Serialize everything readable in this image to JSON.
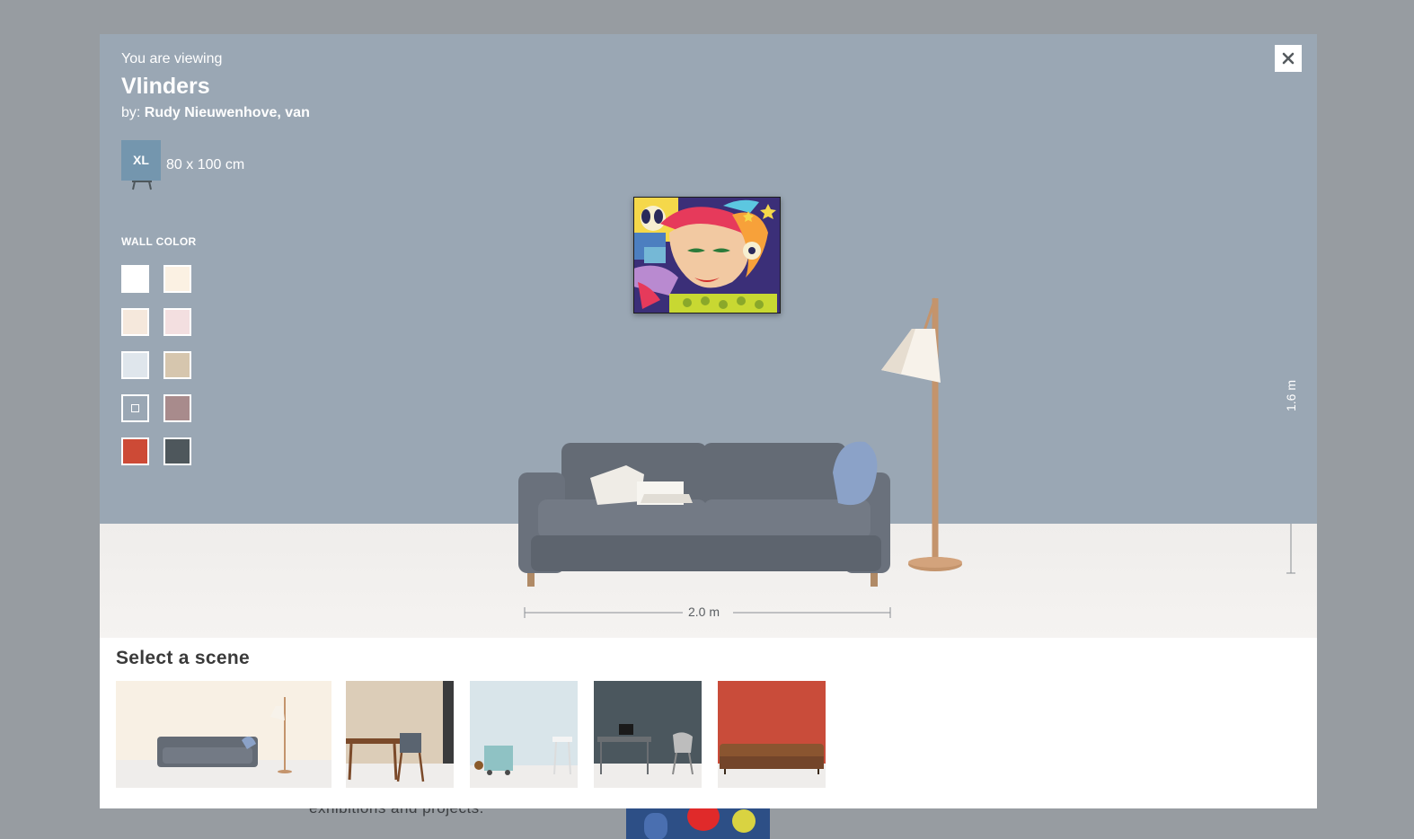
{
  "background": {
    "text": "exhibitions and projects."
  },
  "header": {
    "viewing_label": "You are viewing",
    "artwork_title": "Vlinders",
    "by_prefix": "by:",
    "artist_name": "Rudy Nieuwenhove, van"
  },
  "size": {
    "badge": "XL",
    "dimensions": "80 x 100 cm"
  },
  "wall_color": {
    "label": "WALL COLOR",
    "swatches": [
      "#ffffff",
      "#fbf1e3",
      "#f5e8dc",
      "#f3dfe0",
      "#dfe6ec",
      "#d6c6ae",
      "custom",
      "#a88b8c",
      "#cd4a36",
      "#4e575c"
    ]
  },
  "measurements": {
    "height": "1.6 m",
    "width": "2.0 m"
  },
  "scene_picker": {
    "title": "Select a scene",
    "scenes": [
      {
        "name": "living-room-sofa",
        "wall": "#f8f0e4"
      },
      {
        "name": "dining-table",
        "wall": "#dccdb8"
      },
      {
        "name": "kids-room",
        "wall": "#d9e5ea"
      },
      {
        "name": "office-desk",
        "wall": "#4b575e"
      },
      {
        "name": "chesterfield",
        "wall": "#c94c3a"
      }
    ]
  },
  "close": {
    "icon": "close-icon"
  }
}
